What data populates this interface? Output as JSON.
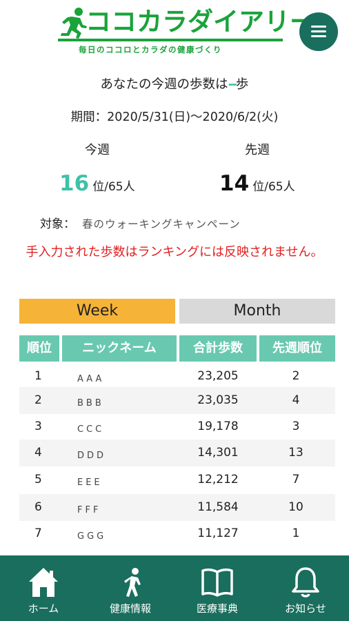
{
  "app": {
    "logo_title": "ココカラダイアリー",
    "logo_tagline": "毎日のココロとカラダの健康づくり"
  },
  "summary": {
    "title_prefix": "あなたの今週の歩数は",
    "title_value": "--",
    "title_suffix": "歩",
    "period": "期間：2020/5/31(日)〜2020/6/2(火)",
    "this_week_label": "今週",
    "last_week_label": "先週",
    "this_week_rank": "16",
    "last_week_rank": "14",
    "rank_unit": "位/65人",
    "target_label": "対象：",
    "target_value": "春のウォーキングキャンペーン",
    "warning": "手入力された歩数はランキングには反映されません。"
  },
  "tabs": {
    "week": "Week",
    "month": "Month",
    "active": "week"
  },
  "table": {
    "headers": [
      "順位",
      "ニックネーム",
      "合計歩数",
      "先週順位"
    ],
    "rows": [
      {
        "rank": "1",
        "nickname": "AAA",
        "steps": "23,205",
        "prev": "2"
      },
      {
        "rank": "2",
        "nickname": "BBB",
        "steps": "23,035",
        "prev": "4"
      },
      {
        "rank": "3",
        "nickname": "CCC",
        "steps": "19,178",
        "prev": "3"
      },
      {
        "rank": "4",
        "nickname": "DDD",
        "steps": "14,301",
        "prev": "13"
      },
      {
        "rank": "5",
        "nickname": "EEE",
        "steps": "12,212",
        "prev": "7"
      },
      {
        "rank": "6",
        "nickname": "FFF",
        "steps": "11,584",
        "prev": "10"
      },
      {
        "rank": "7",
        "nickname": "GGG",
        "steps": "11,127",
        "prev": "1"
      }
    ]
  },
  "nav": {
    "items": [
      {
        "label": "ホーム",
        "icon": "home-icon"
      },
      {
        "label": "健康情報",
        "icon": "stretch-person-icon"
      },
      {
        "label": "医療事典",
        "icon": "book-icon"
      },
      {
        "label": "お知らせ",
        "icon": "bell-icon"
      }
    ]
  },
  "colors": {
    "brand_green": "#1aa33a",
    "dark_teal": "#1a6e5e",
    "header_teal": "#68c9b0",
    "accent_teal": "#3ec2a8",
    "week_tab": "#f5b338",
    "month_tab": "#d9d9d9",
    "warning_red": "#e02020"
  }
}
